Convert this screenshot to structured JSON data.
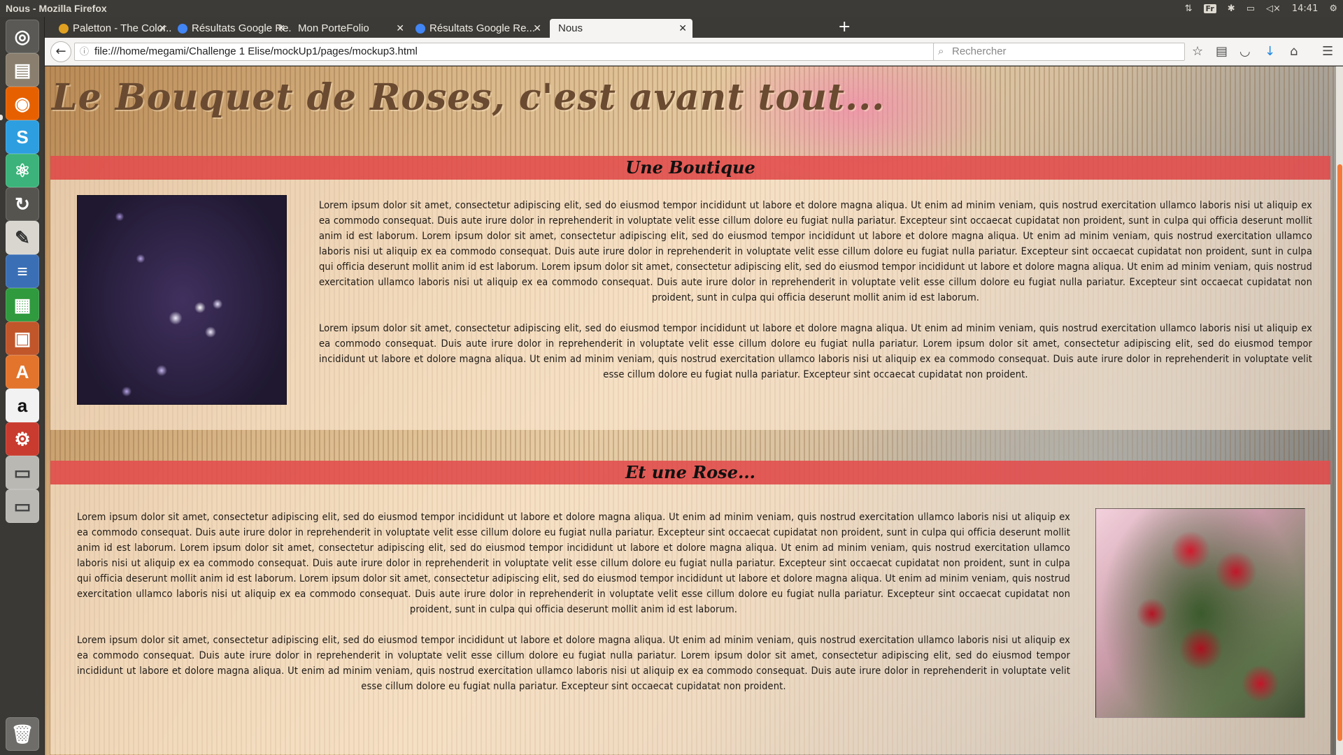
{
  "os": {
    "window_title": "Nous - Mozilla Firefox",
    "keyboard_layout": "Fr",
    "clock": "14:41",
    "launcher_icons": [
      "ubuntu-dash-icon",
      "files-icon",
      "firefox-icon",
      "slack-icon",
      "atom-icon",
      "software-updater-icon",
      "text-editor-icon",
      "writer-icon",
      "calc-icon",
      "impress-icon",
      "software-center-icon",
      "amazon-icon",
      "system-settings-icon",
      "drive-icon",
      "drive-icon",
      "trash-icon"
    ]
  },
  "browser": {
    "tabs": [
      {
        "label": "Paletton - The Color...",
        "active": false
      },
      {
        "label": "Résultats Google Re...",
        "active": false
      },
      {
        "label": "Mon PorteFolio",
        "active": false
      },
      {
        "label": "Résultats Google Re...",
        "active": false
      },
      {
        "label": "Nous",
        "active": true
      }
    ],
    "url": "file:///home/megami/Challenge 1 Elise/mockUp1/pages/mockup3.html",
    "search_placeholder": "Rechercher",
    "accent": "#f47a3b"
  },
  "page": {
    "headline": "Le Bouquet de Roses, c'est avant tout...",
    "sections": [
      {
        "title": "Une Boutique",
        "image": "purple-flowers",
        "paragraphs": [
          "Lorem ipsum dolor sit amet, consectetur adipiscing elit, sed do eiusmod tempor incididunt ut labore et dolore magna aliqua. Ut enim ad minim veniam, quis nostrud exercitation ullamco laboris nisi ut aliquip ex ea commodo consequat. Duis aute irure dolor in reprehenderit in voluptate velit esse cillum dolore eu fugiat nulla pariatur. Excepteur sint occaecat cupidatat non proident, sunt in culpa qui officia deserunt mollit anim id est laborum. Lorem ipsum dolor sit amet, consectetur adipiscing elit, sed do eiusmod tempor incididunt ut labore et dolore magna aliqua. Ut enim ad minim veniam, quis nostrud exercitation ullamco laboris nisi ut aliquip ex ea commodo consequat. Duis aute irure dolor in reprehenderit in voluptate velit esse cillum dolore eu fugiat nulla pariatur. Excepteur sint occaecat cupidatat non proident, sunt in culpa qui officia deserunt mollit anim id est laborum. Lorem ipsum dolor sit amet, consectetur adipiscing elit, sed do eiusmod tempor incididunt ut labore et dolore magna aliqua. Ut enim ad minim veniam, quis nostrud exercitation ullamco laboris nisi ut aliquip ex ea commodo consequat. Duis aute irure dolor in reprehenderit in voluptate velit esse cillum dolore eu fugiat nulla pariatur. Excepteur sint occaecat cupidatat non proident, sunt in culpa qui officia deserunt mollit anim id est laborum.",
          "Lorem ipsum dolor sit amet, consectetur adipiscing elit, sed do eiusmod tempor incididunt ut labore et dolore magna aliqua. Ut enim ad minim veniam, quis nostrud exercitation ullamco laboris nisi ut aliquip ex ea commodo consequat. Duis aute irure dolor in reprehenderit in voluptate velit esse cillum dolore eu fugiat nulla pariatur. Lorem ipsum dolor sit amet, consectetur adipiscing elit, sed do eiusmod tempor incididunt ut labore et dolore magna aliqua. Ut enim ad minim veniam, quis nostrud exercitation ullamco laboris nisi ut aliquip ex ea commodo consequat. Duis aute irure dolor in reprehenderit in voluptate velit esse cillum dolore eu fugiat nulla pariatur. Excepteur sint occaecat cupidatat non proident."
        ]
      },
      {
        "title": "Et une Rose...",
        "image": "red-roses",
        "paragraphs": [
          "Lorem ipsum dolor sit amet, consectetur adipiscing elit, sed do eiusmod tempor incididunt ut labore et dolore magna aliqua. Ut enim ad minim veniam, quis nostrud exercitation ullamco laboris nisi ut aliquip ex ea commodo consequat. Duis aute irure dolor in reprehenderit in voluptate velit esse cillum dolore eu fugiat nulla pariatur. Excepteur sint occaecat cupidatat non proident, sunt in culpa qui officia deserunt mollit anim id est laborum. Lorem ipsum dolor sit amet, consectetur adipiscing elit, sed do eiusmod tempor incididunt ut labore et dolore magna aliqua. Ut enim ad minim veniam, quis nostrud exercitation ullamco laboris nisi ut aliquip ex ea commodo consequat. Duis aute irure dolor in reprehenderit in voluptate velit esse cillum dolore eu fugiat nulla pariatur. Excepteur sint occaecat cupidatat non proident, sunt in culpa qui officia deserunt mollit anim id est laborum. Lorem ipsum dolor sit amet, consectetur adipiscing elit, sed do eiusmod tempor incididunt ut labore et dolore magna aliqua. Ut enim ad minim veniam, quis nostrud exercitation ullamco laboris nisi ut aliquip ex ea commodo consequat. Duis aute irure dolor in reprehenderit in voluptate velit esse cillum dolore eu fugiat nulla pariatur. Excepteur sint occaecat cupidatat non proident, sunt in culpa qui officia deserunt mollit anim id est laborum.",
          "Lorem ipsum dolor sit amet, consectetur adipiscing elit, sed do eiusmod tempor incididunt ut labore et dolore magna aliqua. Ut enim ad minim veniam, quis nostrud exercitation ullamco laboris nisi ut aliquip ex ea commodo consequat. Duis aute irure dolor in reprehenderit in voluptate velit esse cillum dolore eu fugiat nulla pariatur. Lorem ipsum dolor sit amet, consectetur adipiscing elit, sed do eiusmod tempor incididunt ut labore et dolore magna aliqua. Ut enim ad minim veniam, quis nostrud exercitation ullamco laboris nisi ut aliquip ex ea commodo consequat. Duis aute irure dolor in reprehenderit in voluptate velit esse cillum dolore eu fugiat nulla pariatur. Excepteur sint occaecat cupidatat non proident."
        ]
      }
    ]
  }
}
